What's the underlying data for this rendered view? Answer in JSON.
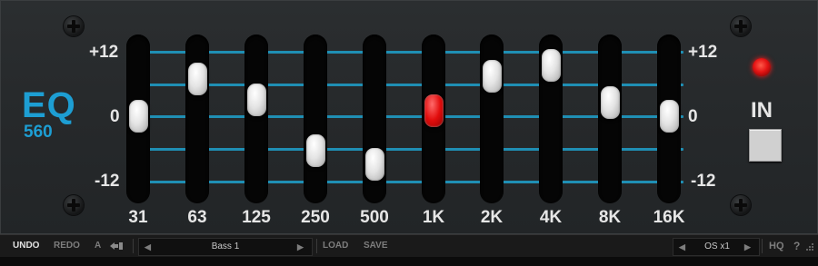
{
  "logo": {
    "title": "EQ",
    "model": "560"
  },
  "scale": {
    "top": "+12",
    "mid": "0",
    "bottom": "-12"
  },
  "bands": [
    {
      "freq": "31",
      "gain_db": 0.0
    },
    {
      "freq": "63",
      "gain_db": 7.0
    },
    {
      "freq": "125",
      "gain_db": 3.0
    },
    {
      "freq": "250",
      "gain_db": -6.5
    },
    {
      "freq": "500",
      "gain_db": -9.0
    },
    {
      "freq": "1K",
      "gain_db": 1.0
    },
    {
      "freq": "2K",
      "gain_db": 7.5
    },
    {
      "freq": "4K",
      "gain_db": 9.5
    },
    {
      "freq": "8K",
      "gain_db": 2.5
    },
    {
      "freq": "16K",
      "gain_db": 0.0
    }
  ],
  "active_band": "1K",
  "in": {
    "label": "IN",
    "led": "on"
  },
  "toolbar": {
    "undo": "UNDO",
    "redo": "REDO",
    "ab": "A",
    "ab_icon": "copy-arrow-icon",
    "preset_prev": "◀",
    "preset": "Bass 1",
    "preset_next": "▶",
    "load": "LOAD",
    "save": "SAVE",
    "os_prev": "◀",
    "os": "OS x1",
    "os_next": "▶",
    "hq": "HQ",
    "help": "?"
  },
  "colors": {
    "accent": "#1d9ed3",
    "led": "#e41414",
    "active_knob": "#e20d0d"
  }
}
